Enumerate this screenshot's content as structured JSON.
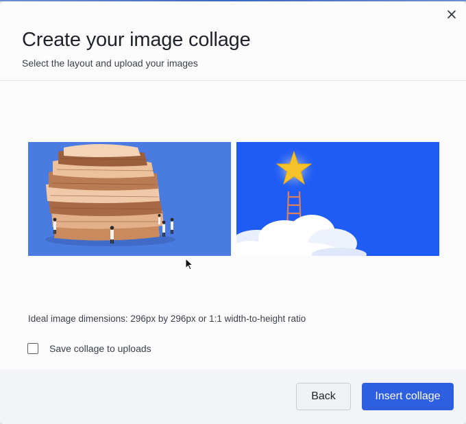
{
  "dialog": {
    "title": "Create your image collage",
    "subtitle": "Select the layout and upload your images",
    "close_icon": "close-icon"
  },
  "collage": {
    "images": [
      {
        "subject": "stack-of-newspapers"
      },
      {
        "subject": "star-above-ladder-on-cloud"
      }
    ]
  },
  "hint": "Ideal image dimensions: 296px by 296px or 1:1 width-to-height ratio",
  "save_to_uploads": {
    "label": "Save collage to uploads",
    "checked": false
  },
  "footer": {
    "back_label": "Back",
    "insert_label": "Insert collage"
  },
  "colors": {
    "accent": "#2d5fe0",
    "image1_bg": "#4a7be0",
    "image2_bg": "#1f5cf5"
  }
}
